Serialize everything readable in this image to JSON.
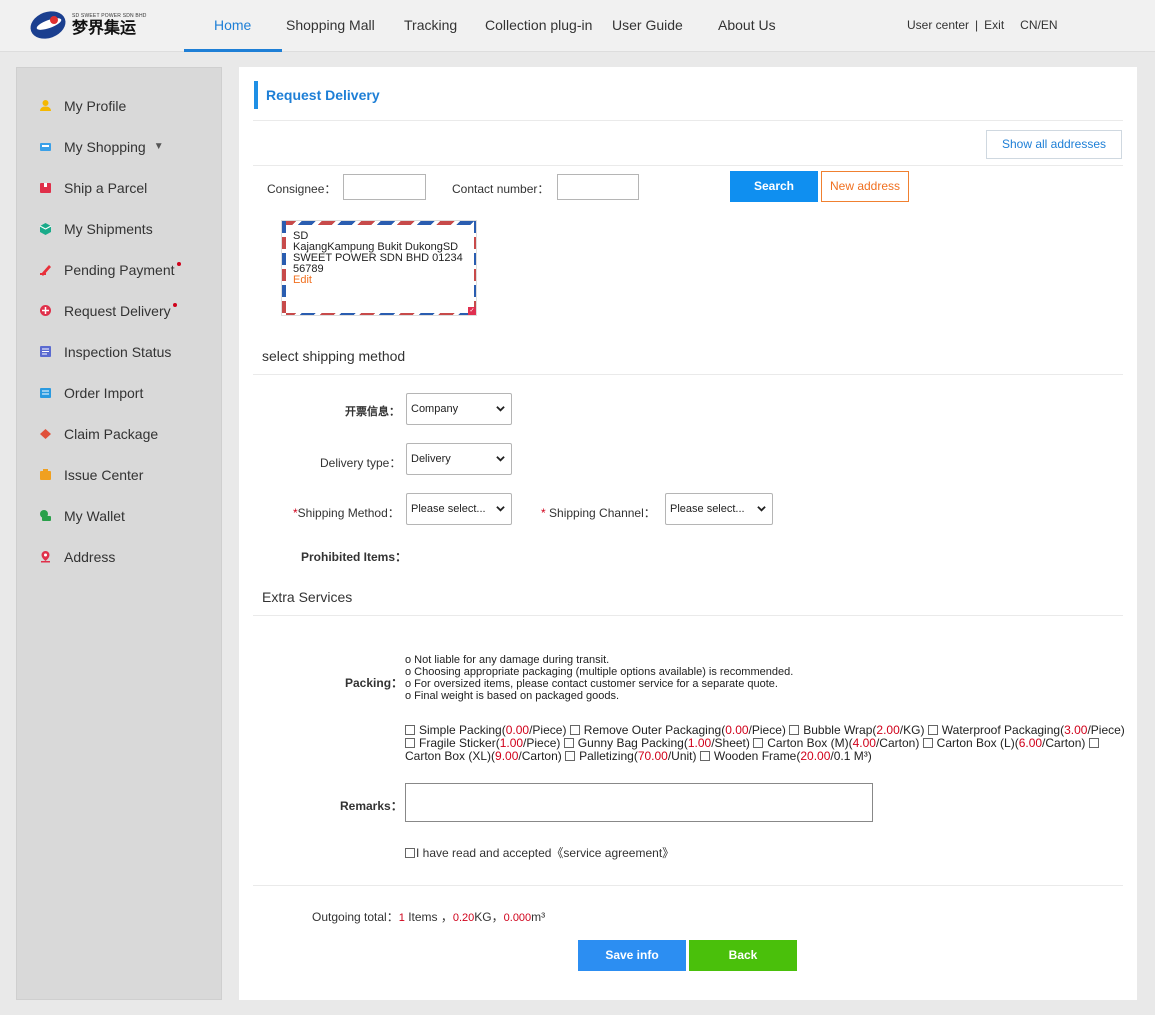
{
  "header": {
    "logo_small": "SD SWEET POWER SDN BHD",
    "logo_cn": "梦界集运",
    "nav": [
      "Home",
      "Shopping Mall",
      "Tracking",
      "Collection plug-in",
      "User Guide",
      "About Us"
    ],
    "user_center": "User center",
    "sep": "|",
    "exit": "Exit",
    "lang": "CN/EN"
  },
  "sidebar": {
    "items": [
      {
        "label": "My Profile",
        "icon": "user-icon",
        "color": "#f5b800"
      },
      {
        "label": "My Shopping",
        "icon": "cart-icon",
        "color": "#3aa0e8"
      },
      {
        "label": "Ship a Parcel",
        "icon": "parcel-icon",
        "color": "#e0304a"
      },
      {
        "label": "My Shipments",
        "icon": "box-icon",
        "color": "#1aab8a"
      },
      {
        "label": "Pending Payment",
        "icon": "payment-icon",
        "color": "#e8303a"
      },
      {
        "label": "Request Delivery",
        "icon": "delivery-icon",
        "color": "#e0304a"
      },
      {
        "label": "Inspection Status",
        "icon": "inspection-icon",
        "color": "#5a6ad0"
      },
      {
        "label": "Order Import",
        "icon": "import-icon",
        "color": "#2a9ae0"
      },
      {
        "label": "Claim Package",
        "icon": "claim-icon",
        "color": "#e0503a"
      },
      {
        "label": "Issue Center",
        "icon": "issue-icon",
        "color": "#f0a020"
      },
      {
        "label": "My Wallet",
        "icon": "wallet-icon",
        "color": "#2aa04a"
      },
      {
        "label": "Address",
        "icon": "location-icon",
        "color": "#e0304a"
      }
    ]
  },
  "main": {
    "title": "Request Delivery",
    "show_all": "Show all addresses",
    "consignee_label": "Consignee：",
    "contact_label": "Contact number：",
    "search": "Search",
    "new_address": "New address",
    "address": {
      "line1": "SD",
      "line2": "KajangKampung Bukit DukongSD",
      "line3": "SWEET POWER SDN BHD 01234",
      "line4": "56789",
      "edit": "Edit"
    },
    "shipping_section": "select shipping method",
    "invoice_label": "开票信息：",
    "invoice_value": "Company",
    "delivery_type_label": "Delivery type：",
    "delivery_type_value": "Delivery",
    "shipping_method_label": "Shipping Method：",
    "shipping_method_value": "Please select...",
    "shipping_channel_label": "Shipping Channel：",
    "shipping_channel_value": "Please select...",
    "required_mark": "*",
    "prohibited_label": "Prohibited Items：",
    "extra_section": "Extra Services",
    "packing_label": "Packing：",
    "packing_notes": [
      "o Not liable for any damage during transit.",
      "o Choosing appropriate packaging (multiple options available) is recommended.",
      "o For oversized items, please contact customer service for a separate quote.",
      "o Final weight is based on packaged goods."
    ],
    "packing_options": [
      {
        "name": "Simple Packing",
        "price": "0.00",
        "unit": "/Piece"
      },
      {
        "name": "Remove Outer Packaging",
        "price": "0.00",
        "unit": "/Piece"
      },
      {
        "name": "Bubble Wrap",
        "price": "2.00",
        "unit": "/KG"
      },
      {
        "name": "Waterproof Packaging",
        "price": "3.00",
        "unit": "/Piece"
      },
      {
        "name": "Fragile Sticker",
        "price": "1.00",
        "unit": "/Piece"
      },
      {
        "name": "Gunny Bag Packing",
        "price": "1.00",
        "unit": "/Sheet"
      },
      {
        "name": "Carton Box (M)",
        "price": "4.00",
        "unit": "/Carton"
      },
      {
        "name": "Carton Box (L)",
        "price": "6.00",
        "unit": "/Carton"
      },
      {
        "name": "Carton Box (XL)",
        "price": "9.00",
        "unit": "/Carton"
      },
      {
        "name": "Palletizing",
        "price": "70.00",
        "unit": "/Unit"
      },
      {
        "name": "Wooden Frame",
        "price": "20.00",
        "unit": "/0.1 M³"
      }
    ],
    "remarks_label": "Remarks：",
    "agree_text": "I have read and accepted《service agreement》",
    "total_label": "Outgoing total：",
    "total_items": "1",
    "total_items_unit": " Items ，",
    "total_weight": "0.20",
    "total_weight_unit": "KG，",
    "total_volume": "0.000",
    "total_volume_unit": "m³",
    "save": "Save info",
    "back": "Back"
  }
}
